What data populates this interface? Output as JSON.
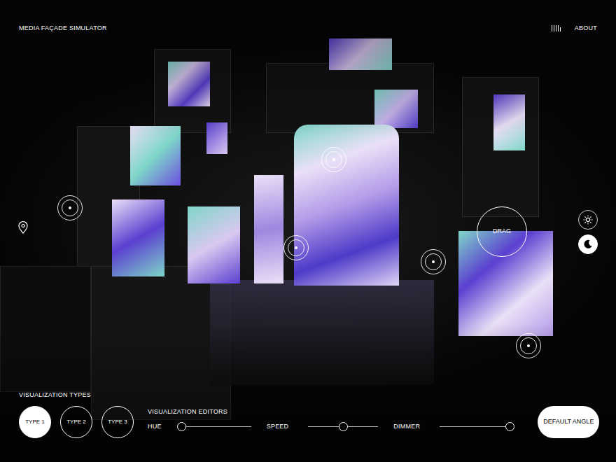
{
  "header": {
    "title": "MEDIA FAÇADE SIMULATOR",
    "about": "ABOUT"
  },
  "scene": {
    "drag_label": "DRAG"
  },
  "theme": [
    {
      "kind": "light",
      "selected": false
    },
    {
      "kind": "dark",
      "selected": true
    }
  ],
  "visualization_types": {
    "label": "VISUALIZATION TYPES",
    "types": [
      {
        "label": "TYPE 1",
        "selected": true
      },
      {
        "label": "TYPE 2",
        "selected": false
      },
      {
        "label": "TYPE 3",
        "selected": false
      }
    ]
  },
  "editors": {
    "label": "VISUALIZATION EDITORS",
    "sliders": [
      {
        "name": "HUE",
        "level": 0
      },
      {
        "name": "SPEED",
        "level": 0.5
      },
      {
        "name": "DIMMER",
        "level": 1
      }
    ]
  },
  "default_angle": "DEFAULT ANGLE"
}
